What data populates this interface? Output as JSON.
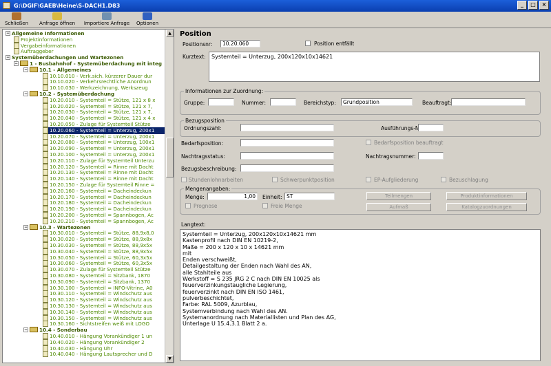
{
  "window": {
    "title": "G:\\DGIF\\GAEB\\Heine\\S-DACH1.D83"
  },
  "toolbar": [
    {
      "label": "Schließen",
      "icon": "close-door-icon"
    },
    {
      "label": "Anfrage öffnen",
      "icon": "open-request-icon"
    },
    {
      "label": "Importiere Anfrage",
      "icon": "import-icon"
    },
    {
      "label": "Optionen",
      "icon": "options-icon"
    }
  ],
  "tree": [
    "Allgemeine Informationen",
    "Projektinformationen",
    "Vergabeinformationen",
    "Auftraggeber",
    "Systemüberdachungen und Wartezonen",
    "1 - Busbahnhof - Systemüberdachung mit integ",
    "10.1 - Allgemeines",
    "10.10.010 - Verk.sich. kürzerer Dauer dur",
    "10.10.020 - Verkehrsrechtliche Anordnun",
    "10.10.030 - Werkzeichnung, Werkszeug",
    "10.2 - Systemüberdachung",
    "10.20.010 - Systemteil = Stütze, 121 x 8 x",
    "10.20.020 - Systemteil = Stütze, 121 x 7,",
    "10.20.030 - Systemteil = Stütze, 121 x 7,",
    "10.20.040 - Systemteil = Stütze, 121 x 4 x",
    "10.20.050 - Zulage für Systemteil Stütze",
    "10.20.060 - Systemteil = Unterzug, 200x1",
    "10.20.070 - Systemteil = Unterzug, 200x1",
    "10.20.080 - Systemteil = Unterzug, 100x1",
    "10.20.090 - Systemteil = Unterzug, 200x1",
    "10.20.100 - Systemteil = Unterzug, 200x1",
    "10.20.110 - Zulage für Systemteil Unterzu",
    "10.20.120 - Systemteil = Rinne mit Dacht",
    "10.20.130 - Systemteil = Rinne mit Dacht",
    "10.20.140 - Systemteil = Rinne mit Dacht",
    "10.20.150 - Zulage für Systemteil Rinne =",
    "10.20.160 - Systemteil = Dacheindeckun",
    "10.20.170 - Systemteil = Dacheindeckun",
    "10.20.180 - Systemteil = Dacheindeckun",
    "10.20.190 - Systemteil = Dacheindeckun",
    "10.20.200 - Systemteil = Spannbogen, Ac",
    "10.20.210 - Systemteil = Spannbogen, Ac",
    "10.3 - Wartezonen",
    "10.30.010 - Systemteil = Stütze, 88,9x8,0",
    "10.30.020 - Systemteil = Stütze, 88,9x8x",
    "10.30.030 - Systemteil = Stütze, 88,9x5x",
    "10.30.040 - Systemteil = Stütze, 88,9x5x",
    "10.30.050 - Systemteil = Stütze, 60,3x5x",
    "10.30.060 - Systemteil = Stütze, 60,3x5x",
    "10.30.070 - Zulage für Systemteil Stütze",
    "10.30.080 - Systemteil = Sitzbank, 1870",
    "10.30.090 - Systemteil = Sitzbank, 1370",
    "10.30.100 - Systemteil = INFO-Vitrine, A0",
    "10.30.110 - Systemteil = Windschutz aus",
    "10.30.120 - Systemteil = Windschutz aus",
    "10.30.130 - Systemteil = Windschutz aus",
    "10.30.140 - Systemteil = Windschutz aus",
    "10.30.150 - Systemteil = Windschutz aus",
    "10.30.160 - Sichtstreifen weiß mit LOGO",
    "10.4 - Sonderbau",
    "10.40.010 - Hängung Vorankündiger 1 un",
    "10.40.020 - Hängung Vorankündiger 2",
    "10.40.030 - Hängung Uhr",
    "10.40.040 - Hängung Lautsprecher und D"
  ],
  "form": {
    "heading": "Position",
    "positionsnr_label": "Positionsnr:",
    "positionsnr": "10.20.060",
    "entfaellt_label": "Position entfällt",
    "kurztext_label": "Kurztext:",
    "kurztext": "Systemteil = Unterzug, 200x120x10x14621",
    "zuordnung_title": "Informationen zur Zuordnung:",
    "gruppe_label": "Gruppe:",
    "nummer_label": "Nummer:",
    "bereichstyp_label": "Bereichstyp:",
    "bereichstyp": "Grundposition",
    "beauftragt_label": "Beauftragt:",
    "bezug_title": "Bezugsposition",
    "ordnungszahl_label": "Ordnungszahl:",
    "ausfuehrungs_label": "Ausführungs-Nr:",
    "bedarf_label": "Bedarfsposition:",
    "bedarf_beauftragt_label": "Bedarfsposition beauftragt",
    "nachtragsstatus_label": "Nachtragsstatus:",
    "nachtragsnummer_label": "Nachtragsnummer:",
    "bezugsbeschreibung_label": "Bezugsbeschreibung:",
    "stundenlohn_label": "Stundenlohnarbeiten",
    "schwerpunkt_label": "Schwerpunktposition",
    "ep_label": "EP-Aufgliederung",
    "bezuschlagung_label": "Bezuschlagung",
    "mengen_title": "Mengenangaben:",
    "menge_label": "Menge:",
    "menge": "1,00",
    "einheit_label": "Einheit:",
    "einheit": "ST",
    "prognose_label": "Prognose",
    "freie_menge_label": "Freie Menge",
    "btn_teilmengen": "Teilmengen",
    "btn_aufmass": "Aufmaß",
    "btn_produktinfo": "Produktinformationen",
    "btn_katalog": "Katalogzuordnungen",
    "langtext_label": "Langtext:",
    "langtext": "Systemteil = Unterzug, 200x120x10x14621 mm\nKastenprofil nach DIN EN 10219-2,\nMaße = 200 x 120 x 10 x 14621 mm\nmit\nEnden verschweißt,\nDetailgestaltung der Enden nach Wahl des AN,\nalle Stahlteile aus\nWerkstoff = S 235 JRG 2 C nach DIN EN 10025 als\nfeuerverzinkungstaugliche Legierung,\nfeuerverzinkt nach DIN EN ISO 1461,\npulverbeschichtet,\nFarbe: RAL 5009, Azurblau,\nSystemverbindung nach Wahl des AN.\nSystemanordnung nach Materiallisten und Plan des AG,\nUnterlage U 15.4.3.1 Blatt 2 a."
  }
}
